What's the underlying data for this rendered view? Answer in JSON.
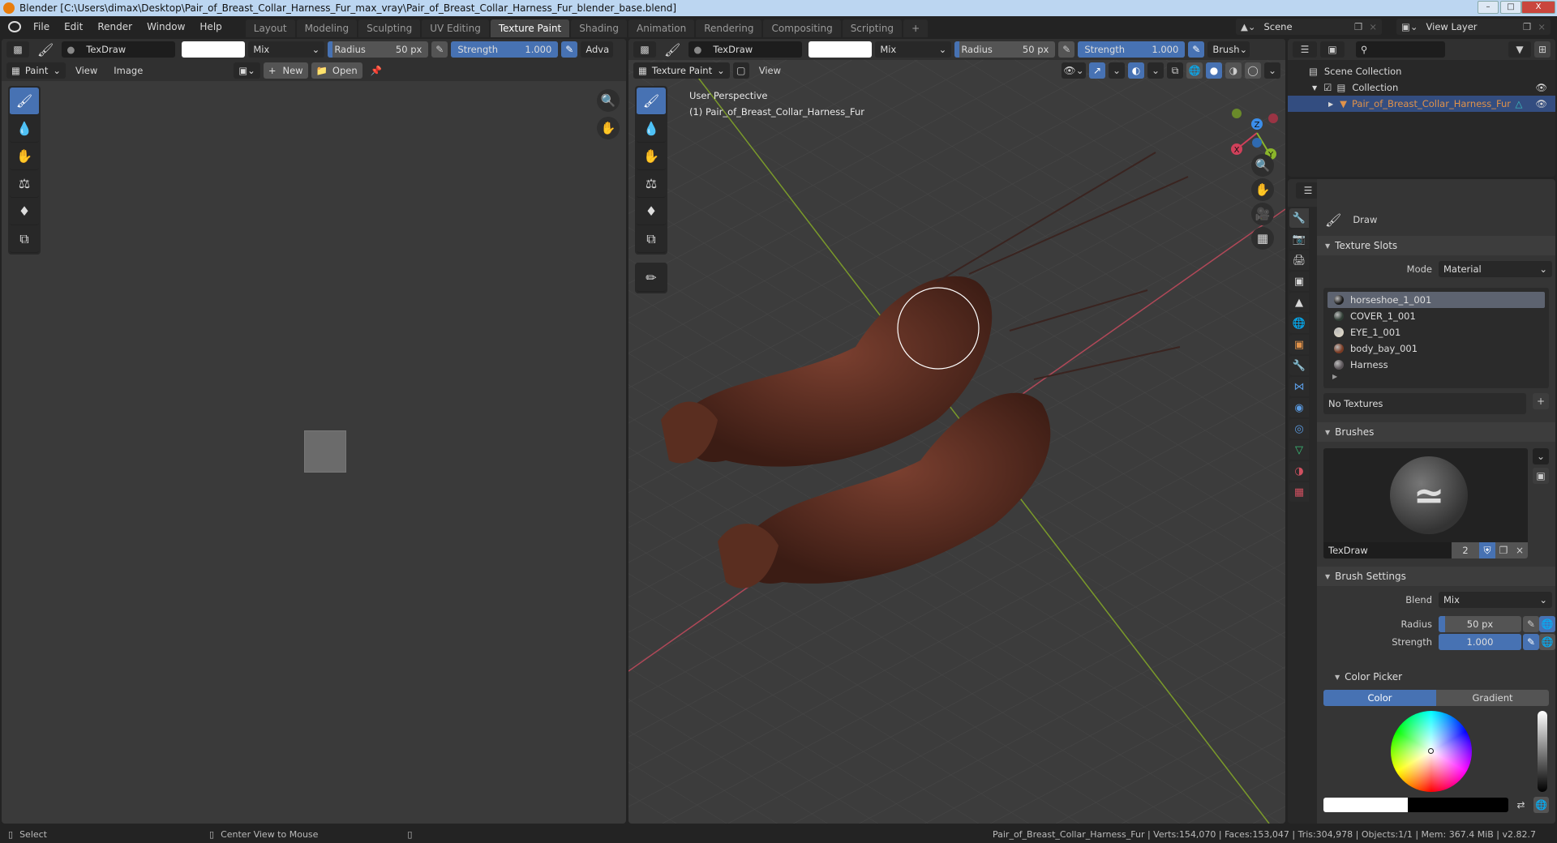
{
  "window": {
    "title": "Blender [C:\\Users\\dimax\\Desktop\\Pair_of_Breast_Collar_Harness_Fur_max_vray\\Pair_of_Breast_Collar_Harness_Fur_blender_base.blend]",
    "minimize": "–",
    "maximize": "□",
    "close": "X"
  },
  "menu": [
    "File",
    "Edit",
    "Render",
    "Window",
    "Help"
  ],
  "workspaces": [
    {
      "label": "Layout",
      "active": false
    },
    {
      "label": "Modeling",
      "active": false
    },
    {
      "label": "Sculpting",
      "active": false
    },
    {
      "label": "UV Editing",
      "active": false
    },
    {
      "label": "Texture Paint",
      "active": true
    },
    {
      "label": "Shading",
      "active": false
    },
    {
      "label": "Animation",
      "active": false
    },
    {
      "label": "Rendering",
      "active": false
    },
    {
      "label": "Compositing",
      "active": false
    },
    {
      "label": "Scripting",
      "active": false
    }
  ],
  "add_workspace": "+",
  "scene": {
    "label": "Scene",
    "view_layer": "View Layer"
  },
  "image_editor": {
    "brush_name": "TexDraw",
    "blend": "Mix",
    "radius_label": "Radius",
    "radius_value": "50 px",
    "strength_label": "Strength",
    "strength_value": "1.000",
    "strength_fraction": 1.0,
    "radius_fraction": 0.03,
    "advanced": "Adva",
    "mode": "Paint",
    "view": "View",
    "image": "Image",
    "new": "New",
    "open": "Open"
  },
  "viewport": {
    "brush_name": "TexDraw",
    "blend": "Mix",
    "radius_label": "Radius",
    "radius_value": "50 px",
    "strength_label": "Strength",
    "strength_value": "1.000",
    "brush_menu": "Brush",
    "mode": "Texture Paint",
    "view": "View",
    "overlay_line1": "User Perspective",
    "overlay_line2": "(1) Pair_of_Breast_Collar_Harness_Fur",
    "gizmo": {
      "x": "X",
      "y": "Y",
      "z": "Z"
    },
    "shading_active": "solid"
  },
  "outliner": {
    "scene_collection": "Scene Collection",
    "collection": "Collection",
    "object": "Pair_of_Breast_Collar_Harness_Fur"
  },
  "properties": {
    "tool_name": "Draw",
    "texture_slots": {
      "title": "Texture Slots",
      "mode_label": "Mode",
      "mode_value": "Material",
      "slots": [
        {
          "name": "horseshoe_1_001",
          "color": "#1a1a1a",
          "active": true
        },
        {
          "name": "COVER_1_001",
          "color": "#2f3d34",
          "active": false
        },
        {
          "name": "EYE_1_001",
          "color": "#d8d2c4",
          "active": false
        },
        {
          "name": "body_bay_001",
          "color": "#7a3a22",
          "active": false
        },
        {
          "name": "Harness",
          "color": "#5a5458",
          "active": false
        }
      ],
      "no_textures": "No Textures",
      "add": "+"
    },
    "brushes": {
      "title": "Brushes",
      "brush_name": "TexDraw",
      "users": "2"
    },
    "brush_settings": {
      "title": "Brush Settings",
      "blend_label": "Blend",
      "blend_value": "Mix",
      "radius_label": "Radius",
      "radius_value": "50 px",
      "strength_label": "Strength",
      "strength_value": "1.000"
    },
    "color_picker": {
      "title": "Color Picker",
      "tab_color": "Color",
      "tab_gradient": "Gradient",
      "value": 1.0,
      "primary": "#ffffff",
      "secondary": "#000000"
    }
  },
  "statusbar": {
    "select": "Select",
    "center_view": "Center View to Mouse",
    "stats": "Pair_of_Breast_Collar_Harness_Fur | Verts:154,070 | Faces:153,047 | Tris:304,978 | Objects:1/1 | Mem: 367.4 MiB | v2.82.7"
  },
  "colors": {
    "accent": "#4772b3",
    "x_axis": "#d0405a",
    "y_axis": "#8ab52a",
    "z_axis": "#3b8eea",
    "object_orange": "#e0924a"
  }
}
